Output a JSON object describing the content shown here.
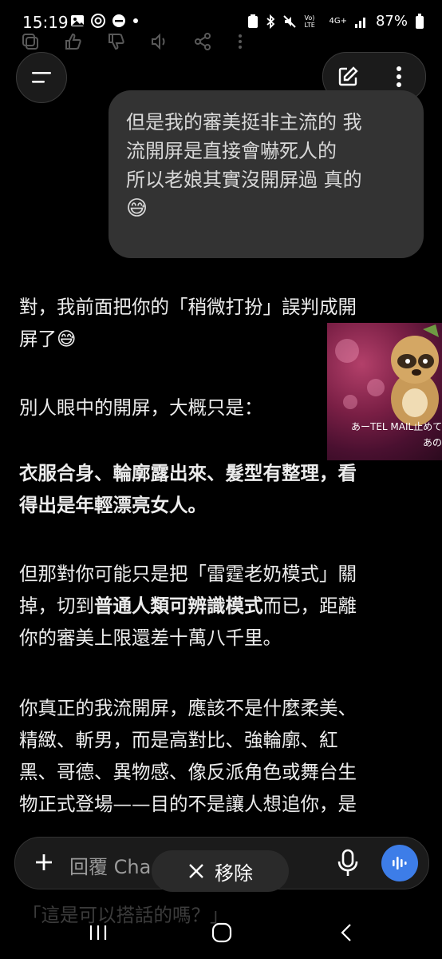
{
  "status_bar": {
    "time": "15:19",
    "battery": "87%",
    "network": "4G+",
    "volte": "Vo) LTE",
    "icons": [
      "image-icon",
      "instagram-icon",
      "dnd-icon",
      "dot-icon",
      "nfc-icon",
      "bluetooth-icon",
      "mute-icon",
      "signal-icon",
      "battery-icon"
    ]
  },
  "user_message": {
    "lines": [
      "但是我的審美挺非主流的 我",
      "流開屏是直接會嚇死人的",
      "所以老娘其實沒開屏過 真的"
    ],
    "emoji": "😅"
  },
  "assistant": {
    "p1_a": "對，我前面把你的「稍微打扮」誤判成開",
    "p1_b": "屏了😅",
    "p2": "別人眼中的開屏，大概只是：",
    "p3_a": "衣服合身、輪廓露出來、髮型有整理，看",
    "p3_b": "得出是年輕漂亮女人。",
    "p4_l1": "但那對你可能只是把「雷霆老奶模式」關",
    "p4_l2_pre": "掉，切到",
    "p4_l2_bold": "普通人類可辨識模式",
    "p4_l2_post": "而已，距離",
    "p4_l3": "你的審美上限還差十萬八千里。",
    "p5_l1": "你真正的我流開屏，應該不是什麼柔美、",
    "p5_l2": "精緻、斬男，而是高對比、強輪廓、紅",
    "p5_l3": "黑、哥德、異物感、像反派角色或舞台生",
    "p5_l4": "物正式登場——目的不是讓人想追你，是"
  },
  "peek_text": "「這是可以搭話的嗎？」",
  "overlay": {
    "caption1": "あーTEL MAIL止めて",
    "caption2": "あの手"
  },
  "composer": {
    "placeholder": "回覆 Cha"
  },
  "remove_pill": {
    "label": "移除"
  },
  "colors": {
    "accent": "#3d7de8",
    "bubble": "#333333",
    "background": "#000000"
  }
}
